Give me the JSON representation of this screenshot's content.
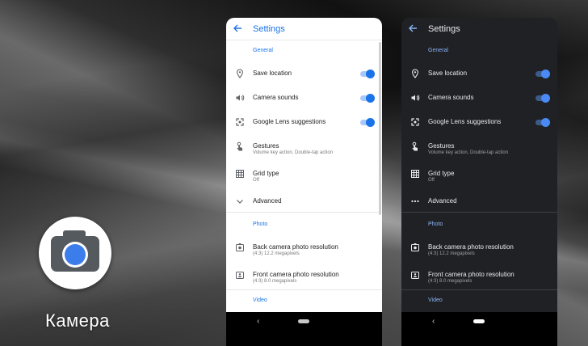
{
  "app": {
    "label": "Камера"
  },
  "screen": {
    "title": "Settings",
    "back_icon": "arrow-left-icon",
    "sections": {
      "general": "General",
      "photo": "Photo",
      "video": "Video"
    },
    "items": {
      "save_location": {
        "title": "Save location",
        "icon": "location-pin-icon",
        "enabled": true
      },
      "camera_sounds": {
        "title": "Camera sounds",
        "icon": "volume-icon",
        "enabled": true
      },
      "lens": {
        "title": "Google Lens suggestions",
        "icon": "lens-icon",
        "enabled": true
      },
      "gestures": {
        "title": "Gestures",
        "subtitle": "Volume key action, Double-tap action",
        "icon": "gesture-hand-icon"
      },
      "grid": {
        "title": "Grid type",
        "subtitle": "Off",
        "icon": "grid-icon"
      },
      "advanced": {
        "title": "Advanced",
        "icon_light": "chevron-down-icon",
        "icon_dark": "more-dots-icon"
      },
      "back_res": {
        "title": "Back camera photo resolution",
        "subtitle": "(4:3) 12.2 megapixels",
        "icon": "camera-back-icon"
      },
      "front_res": {
        "title": "Front camera photo resolution",
        "subtitle": "(4:3) 8.0 megapixels",
        "icon": "camera-front-icon"
      }
    }
  },
  "colors": {
    "accent_light": "#1a73e8",
    "accent_dark": "#8ab4f8",
    "dark_bg": "#202124",
    "lens_blue": "#3b7dea"
  },
  "nav": {
    "back": "‹"
  }
}
